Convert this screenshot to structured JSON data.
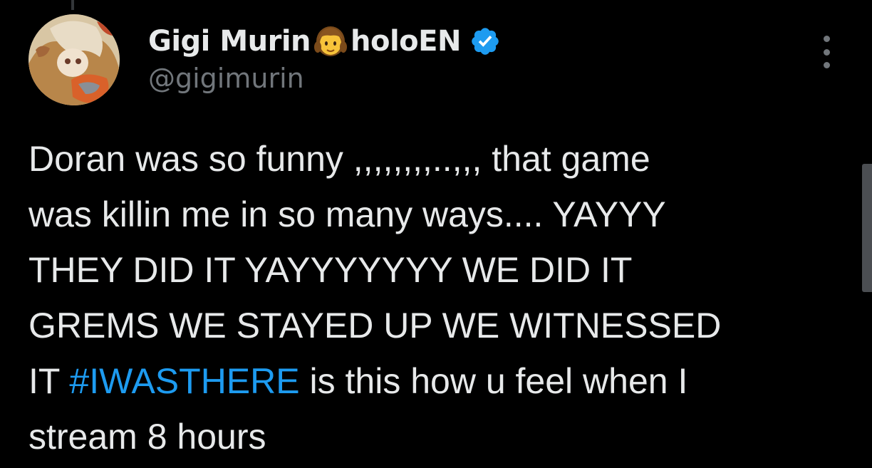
{
  "author": {
    "display_name_part1": "Gigi Murin",
    "display_name_part2": "holoEN",
    "name_emoji": "girl-emoji",
    "handle": "@gigimurin",
    "verified": true,
    "avatar": "avatar-image"
  },
  "tweet": {
    "line1": "Doran was so funny ,,,,,,,,..,,, that game",
    "line2": "was killin me in so many ways.... YAYYY",
    "line3": "THEY DID IT YAYYYYYYY WE DID IT",
    "line4": "GREMS WE STAYED UP WE WITNESSED",
    "line5_prefix": "IT ",
    "hashtag": "#IWASTHERE",
    "line5_suffix": " is this how u feel when I",
    "line6": "stream 8 hours"
  },
  "icons": {
    "more": "more-vertical-icon",
    "verified": "verified-badge-icon"
  },
  "colors": {
    "background": "#000000",
    "text": "#e7e9ea",
    "secondary_text": "#71767b",
    "link": "#1d9bf0",
    "verified": "#1d9bf0"
  }
}
